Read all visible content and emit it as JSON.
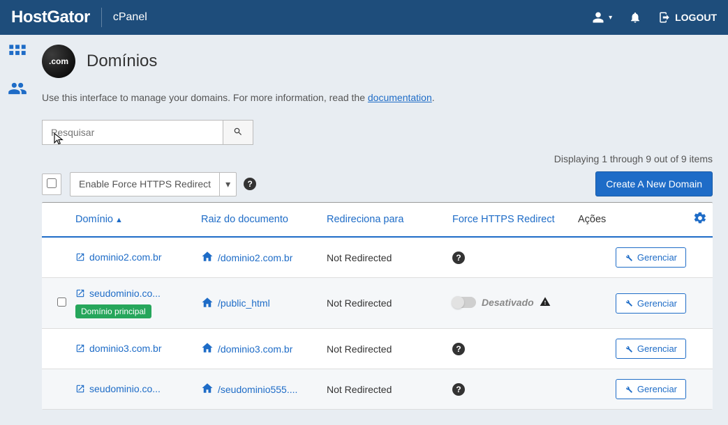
{
  "topbar": {
    "brand": "HostGator",
    "product": "cPanel",
    "logout": "LOGOUT"
  },
  "page": {
    "icon_label": ".com",
    "title": "Domínios",
    "intro_prefix": "Use this interface to manage your domains. For more information, read the ",
    "intro_link": "documentation",
    "intro_suffix": "."
  },
  "search": {
    "placeholder": "Pesquisar"
  },
  "toolbar": {
    "force_https_label": "Enable Force HTTPS Redirect",
    "display_count": "Displaying 1 through 9 out of 9 items",
    "create_button": "Create A New Domain"
  },
  "table": {
    "headers": {
      "domain": "Domínio",
      "doc_root": "Raiz do documento",
      "redirects": "Redireciona para",
      "force_https": "Force HTTPS Redirect",
      "actions": "Ações"
    },
    "manage_label": "Gerenciar",
    "main_badge": "Domínio principal",
    "disabled_label": "Desativado",
    "rows": [
      {
        "domain": "dominio2.com.br",
        "root": "/dominio2.com.br",
        "redirect": "Not Redirected",
        "https_mode": "question",
        "main": false
      },
      {
        "domain": "seudominio.co...",
        "root": "/public_html",
        "redirect": "Not Redirected",
        "https_mode": "disabled",
        "main": true
      },
      {
        "domain": "dominio3.com.br",
        "root": "/dominio3.com.br",
        "redirect": "Not Redirected",
        "https_mode": "question",
        "main": false
      },
      {
        "domain": "seudominio.co...",
        "root": "/seudominio555....",
        "redirect": "Not Redirected",
        "https_mode": "question",
        "main": false
      }
    ]
  }
}
